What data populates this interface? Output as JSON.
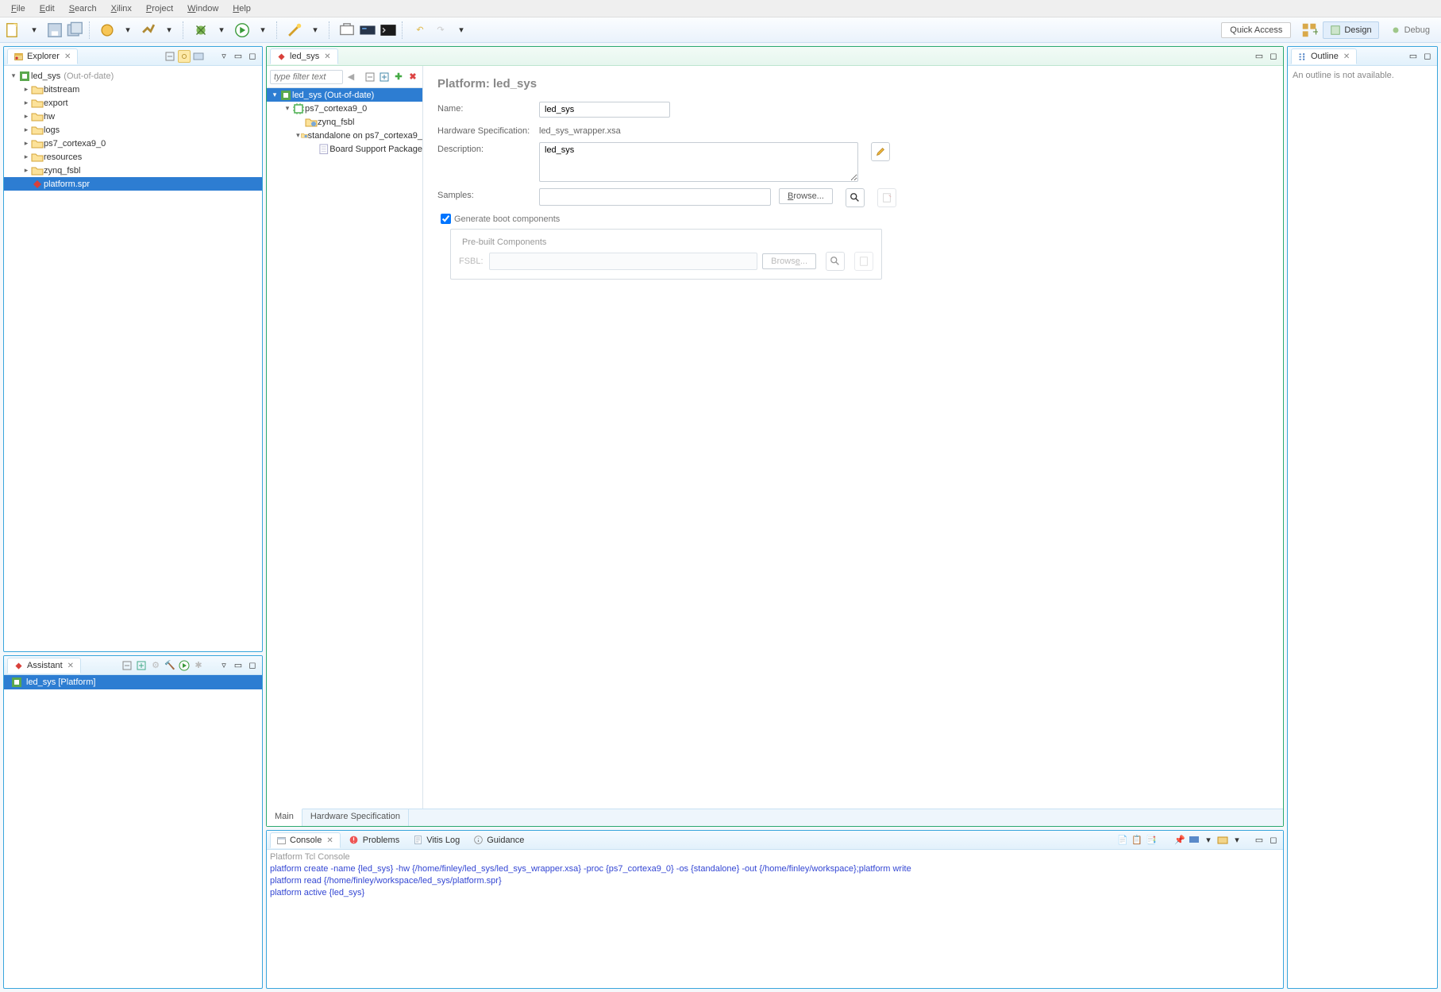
{
  "menu": {
    "items": [
      "File",
      "Edit",
      "Search",
      "Xilinx",
      "Project",
      "Window",
      "Help"
    ]
  },
  "toolbar": {
    "quick_access": "Quick Access",
    "persp_design": "Design",
    "persp_debug": "Debug"
  },
  "explorer": {
    "title": "Explorer",
    "root": {
      "name": "led_sys",
      "status": "(Out-of-date)"
    },
    "folders": [
      "bitstream",
      "export",
      "hw",
      "logs",
      "ps7_cortexa9_0",
      "resources",
      "zynq_fsbl"
    ],
    "file": "platform.spr"
  },
  "assistant": {
    "title": "Assistant",
    "item": "led_sys [Platform]"
  },
  "editor": {
    "tab": "led_sys",
    "filter_placeholder": "type filter text",
    "tree": {
      "root": "led_sys (Out-of-date)",
      "proc": "ps7_cortexa9_0",
      "domain1": "zynq_fsbl",
      "domain2_prefix": "standalone on ps7_cortexa9_",
      "bsp": "Board Support Package"
    },
    "platform_title": "Platform: led_sys",
    "labels": {
      "name": "Name:",
      "hw": "Hardware Specification:",
      "desc": "Description:",
      "samples": "Samples:",
      "browse": "Browse...",
      "browse_u": "Browse...",
      "gen": "Generate boot components",
      "prebuilt": "Pre-built Components",
      "fsbl": "FSBL:"
    },
    "values": {
      "name": "led_sys",
      "hw": "led_sys_wrapper.xsa",
      "desc": "led_sys"
    },
    "bottom_tabs": {
      "main": "Main",
      "hw": "Hardware Specification"
    }
  },
  "outline": {
    "title": "Outline",
    "message": "An outline is not available."
  },
  "bottom": {
    "tabs": {
      "console": "Console",
      "problems": "Problems",
      "vitis": "Vitis Log",
      "guidance": "Guidance"
    },
    "console_subtitle": "Platform Tcl Console",
    "lines": [
      "platform create -name {led_sys} -hw {/home/finley/led_sys/led_sys_wrapper.xsa} -proc {ps7_cortexa9_0} -os {standalone} -out {/home/finley/workspace};platform write",
      "platform read {/home/finley/workspace/led_sys/platform.spr}",
      "platform active {led_sys}"
    ]
  }
}
